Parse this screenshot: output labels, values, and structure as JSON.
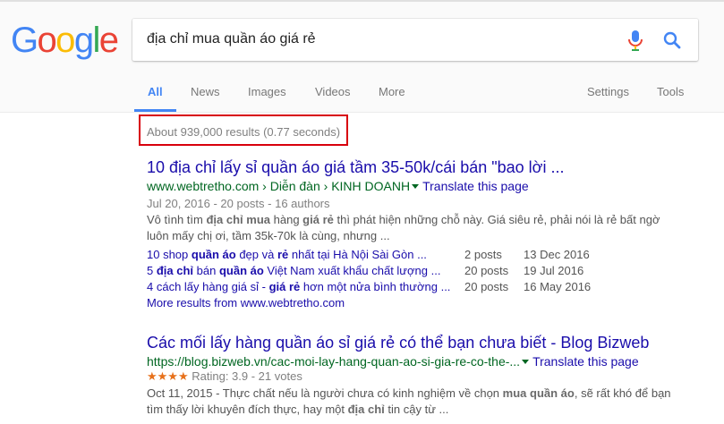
{
  "logo": {
    "letters": [
      {
        "ch": "G",
        "color": "#4285f4"
      },
      {
        "ch": "o",
        "color": "#ea4335"
      },
      {
        "ch": "o",
        "color": "#fbbc05"
      },
      {
        "ch": "g",
        "color": "#4285f4"
      },
      {
        "ch": "l",
        "color": "#34a853"
      },
      {
        "ch": "e",
        "color": "#ea4335"
      }
    ]
  },
  "search": {
    "query": "địa chỉ mua quần áo giá rẻ"
  },
  "tabs": {
    "all": "All",
    "news": "News",
    "images": "Images",
    "videos": "Videos",
    "more": "More",
    "settings": "Settings",
    "tools": "Tools"
  },
  "stats": "About 939,000 results (0.77 seconds)",
  "results": [
    {
      "title": "10 địa chỉ lấy sỉ quần áo giá tầm 35-50k/cái bán \"bao lời ...",
      "url": "www.webtretho.com › Diễn đàn › KINH DOANH",
      "translate": "Translate this page",
      "meta": "Jul 20, 2016 - 20 posts - 16 authors",
      "snippet_line1": "Vô tình tìm <b>địa chỉ mua</b> hàng <b>giá rẻ</b> thì phát hiện những chỗ này. Giá siêu rẻ, phải nói là rẻ bất ngờ",
      "snippet_line2": "luôn mấy chị ơi, tầm 35k-70k là cùng, nhưng ...",
      "sublinks": [
        {
          "text": "10 shop <b>quần áo</b> đẹp và <b>rẻ</b> nhất tại Hà Nội Sài Gòn ...",
          "posts": "2 posts",
          "date": "13 Dec 2016"
        },
        {
          "text": "5 <b>địa chỉ</b> bán <b>quần áo</b> Việt Nam xuất khẩu chất lượng ...",
          "posts": "20 posts",
          "date": "19 Jul 2016"
        },
        {
          "text": "4 cách lấy hàng giá sỉ - <b>giá rẻ</b> hơn một nửa bình thường ...",
          "posts": "20 posts",
          "date": "16 May 2016"
        }
      ],
      "more_results": "More results from www.webtretho.com"
    },
    {
      "title": "Các mối lấy hàng quần áo sỉ giá rẻ có thể bạn chưa biết - Blog Bizweb",
      "url": "https://blog.bizweb.vn/cac-moi-lay-hang-quan-ao-si-gia-re-co-the-...",
      "translate": "Translate this page",
      "stars": "★★★★",
      "rating": "Rating: 3.9 - 21 votes",
      "snippet_line1": "Oct 11, 2015 - Thực chất nếu là người chưa có kinh nghiệm về chọn <b>mua quần áo</b>, sẽ rất khó để bạn",
      "snippet_line2": "tìm thấy lời khuyên đích thực, hay một <b>địa chỉ</b> tin cậy từ ..."
    }
  ],
  "colors": {
    "link": "#1a0dab",
    "url": "#006621",
    "tab_active": "#4285f4",
    "highlight_box": "#d8000c",
    "star": "#e7711b"
  },
  "icons": [
    "microphone-icon",
    "search-icon",
    "dropdown-caret-icon"
  ]
}
